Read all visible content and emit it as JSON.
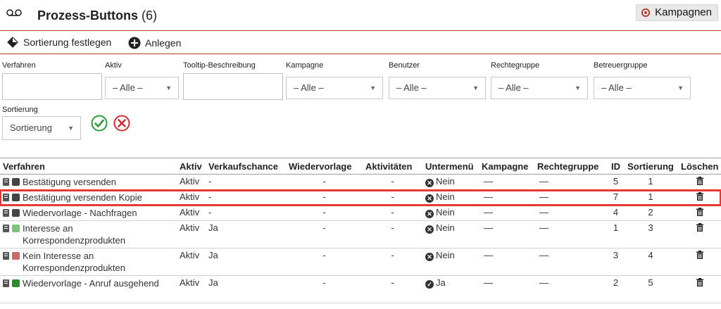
{
  "header": {
    "title": "Prozess-Buttons",
    "count": "(6)",
    "kampagnen_label": "Kampagnen"
  },
  "toolbar": {
    "sort_label": "Sortierung festlegen",
    "create_label": "Anlegen"
  },
  "filters": {
    "verfahren_label": "Verfahren",
    "aktiv_label": "Aktiv",
    "tooltip_label": "Tooltip-Beschreibung",
    "kampagne_label": "Kampagne",
    "benutzer_label": "Benutzer",
    "rechtegruppe_label": "Rechtegruppe",
    "betreuergruppe_label": "Betreuergruppe",
    "all_value": "– Alle –",
    "sortierung_label": "Sortierung",
    "sortierung_value": "Sortierung"
  },
  "table": {
    "columns": [
      "Verfahren",
      "Aktiv",
      "Verkaufschance",
      "Wiedervorlage",
      "Aktivitäten",
      "Untermenü",
      "Kampagne",
      "Rechtegruppe",
      "ID",
      "Sortierung",
      "Löschen"
    ],
    "rows": [
      {
        "verfahren": "Bestätigung versenden",
        "color": "#444444",
        "aktiv": "Aktiv",
        "chance": "-",
        "wv": "-",
        "akt": "-",
        "submenu_icon": "x-circle-icon",
        "submenu": "Nein",
        "kampagne": "—",
        "recht": "—",
        "id": "5",
        "sort": "1"
      },
      {
        "verfahren": "Bestätigung versenden Kopie",
        "color": "#444444",
        "aktiv": "Aktiv",
        "chance": "-",
        "wv": "-",
        "akt": "-",
        "submenu_icon": "x-circle-icon",
        "submenu": "Nein",
        "kampagne": "—",
        "recht": "—",
        "id": "7",
        "sort": "1"
      },
      {
        "verfahren": "Wiedervorlage - Nachfragen",
        "color": "#444444",
        "aktiv": "Aktiv",
        "chance": "-",
        "wv": "-",
        "akt": "-",
        "submenu_icon": "x-circle-icon",
        "submenu": "Nein",
        "kampagne": "—",
        "recht": "—",
        "id": "4",
        "sort": "2"
      },
      {
        "verfahren": "Interesse an Korrespondenzprodukten",
        "color": "#7cc47c",
        "aktiv": "Aktiv",
        "chance": "Ja",
        "wv": "-",
        "akt": "-",
        "submenu_icon": "x-circle-icon",
        "submenu": "Nein",
        "kampagne": "—",
        "recht": "—",
        "id": "1",
        "sort": "3"
      },
      {
        "verfahren": "Kein Interesse an Korrespondenzprodukten",
        "color": "#c96a6a",
        "aktiv": "Aktiv",
        "chance": "Ja",
        "wv": "-",
        "akt": "-",
        "submenu_icon": "x-circle-icon",
        "submenu": "Nein",
        "kampagne": "—",
        "recht": "—",
        "id": "3",
        "sort": "4"
      },
      {
        "verfahren": "Wiedervorlage - Anruf ausgehend",
        "color": "#2e8b2e",
        "aktiv": "Aktiv",
        "chance": "Ja",
        "wv": "-",
        "akt": "-",
        "submenu_icon": "check-circle-icon",
        "submenu": "Ja",
        "kampagne": "—",
        "recht": "—",
        "id": "2",
        "sort": "5"
      }
    ]
  },
  "colors": {
    "accent": "#c0392b",
    "highlight": "#e53935",
    "apply": "#2e9e3a",
    "reset": "#d32f2f"
  }
}
